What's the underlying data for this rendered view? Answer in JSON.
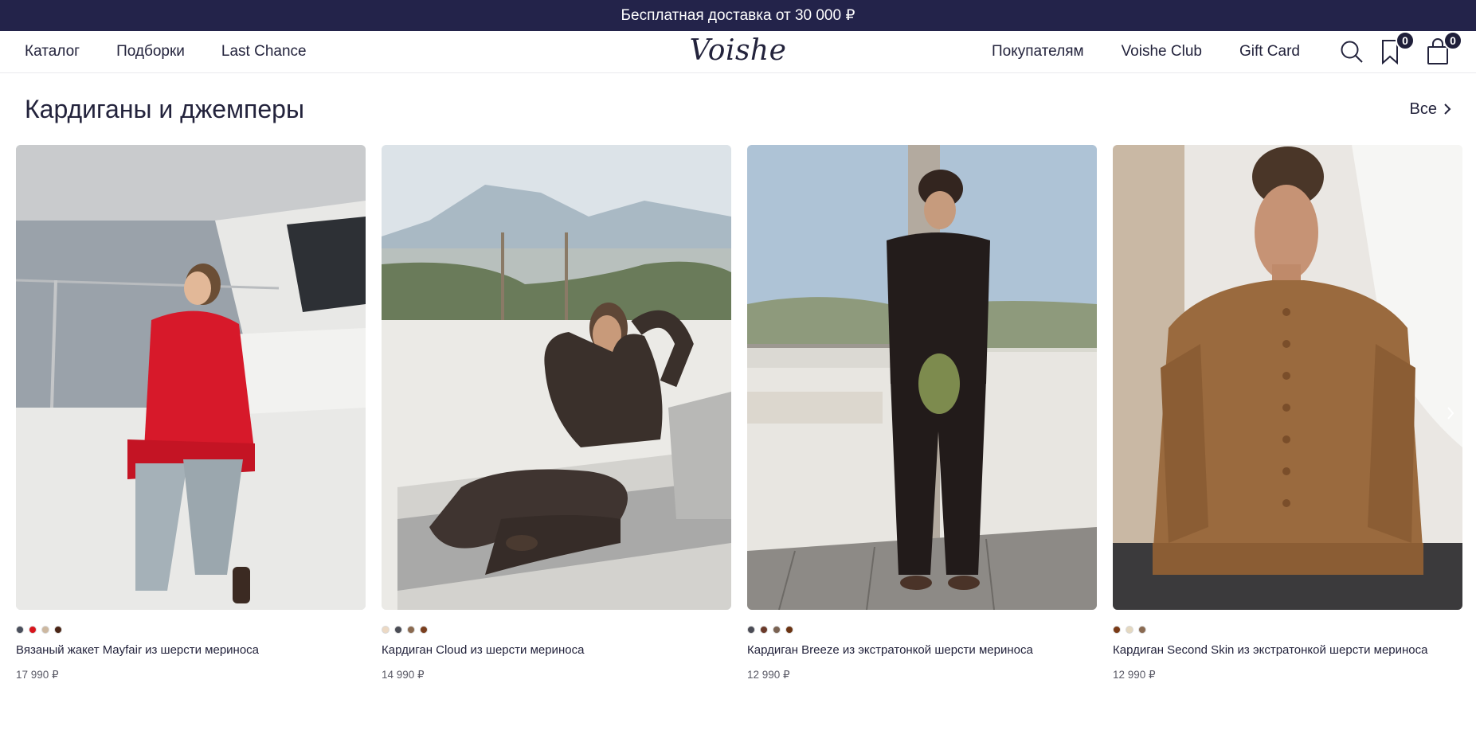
{
  "promo": {
    "text": "Бесплатная доставка от 30 000 ₽"
  },
  "header": {
    "logo": "Voishe",
    "nav_left": [
      "Каталог",
      "Подборки",
      "Last Chance"
    ],
    "nav_right": [
      "Покупателям",
      "Voishe Club",
      "Gift Card"
    ],
    "wishlist_count": "0",
    "cart_count": "0"
  },
  "section": {
    "title": "Кардиганы и джемперы",
    "all_label": "Все"
  },
  "products": [
    {
      "name": "Вязаный жакет Mayfair из шерсти мериноса",
      "price": "17 990 ₽",
      "swatches": [
        "#4a4f5c",
        "#d8141c",
        "#cdb8a0",
        "#4a2516"
      ]
    },
    {
      "name": "Кардиган Cloud из шерсти мериноса",
      "price": "14 990 ₽",
      "swatches": [
        "#ecd9c4",
        "#4b4d56",
        "#8b6a50",
        "#7a3e1e"
      ]
    },
    {
      "name": "Кардиган Breeze из экстратонкой шерсти мериноса",
      "price": "12 990 ₽",
      "swatches": [
        "#4b4c56",
        "#6b3a2a",
        "#7a6252",
        "#6b3312"
      ]
    },
    {
      "name": "Кардиган Second Skin из экстратонкой шерсти мериноса",
      "price": "12 990 ₽",
      "swatches": [
        "#7a3a16",
        "#e4d8c0",
        "#8a6a52"
      ]
    }
  ],
  "colors": {
    "accent": "#23234a",
    "text": "#23233c"
  },
  "icons": [
    "search-icon",
    "bookmark-icon",
    "shopping-bag-icon",
    "chevron-right-icon"
  ]
}
